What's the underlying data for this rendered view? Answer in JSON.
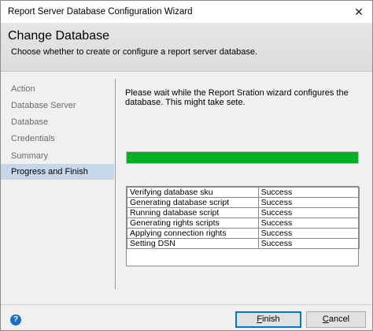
{
  "window": {
    "title": "Report Server Database Configuration Wizard",
    "close_glyph": "✕"
  },
  "header": {
    "title": "Change Database",
    "subtitle": "Choose whether to create or configure a report server database."
  },
  "sidebar": {
    "items": [
      {
        "label": "Action",
        "active": false
      },
      {
        "label": "Database Server",
        "active": false
      },
      {
        "label": "Database",
        "active": false
      },
      {
        "label": "Credentials",
        "active": false
      },
      {
        "label": "Summary",
        "active": false
      },
      {
        "label": "Progress and Finish",
        "active": true
      }
    ]
  },
  "content": {
    "message": "Please wait while the Report Sration wizard configures the database.  This might take sete.",
    "progress_fraction": 1.0
  },
  "results": {
    "rows": [
      {
        "task": "Verifying database sku",
        "status": "Success"
      },
      {
        "task": "Generating database script",
        "status": "Success"
      },
      {
        "task": "Running database script",
        "status": "Success"
      },
      {
        "task": "Generating rights scripts",
        "status": "Success"
      },
      {
        "task": "Applying connection rights",
        "status": "Success"
      },
      {
        "task": "Setting DSN",
        "status": "Success"
      }
    ]
  },
  "footer": {
    "help_glyph": "?",
    "finish_label_first": "F",
    "finish_label_rest": "inish",
    "cancel_label_first": "C",
    "cancel_label_rest": "ancel"
  },
  "colors": {
    "progress_fill": "#06b025",
    "active_item": "#c7d7ea",
    "default_button_border": "#0078d7"
  }
}
